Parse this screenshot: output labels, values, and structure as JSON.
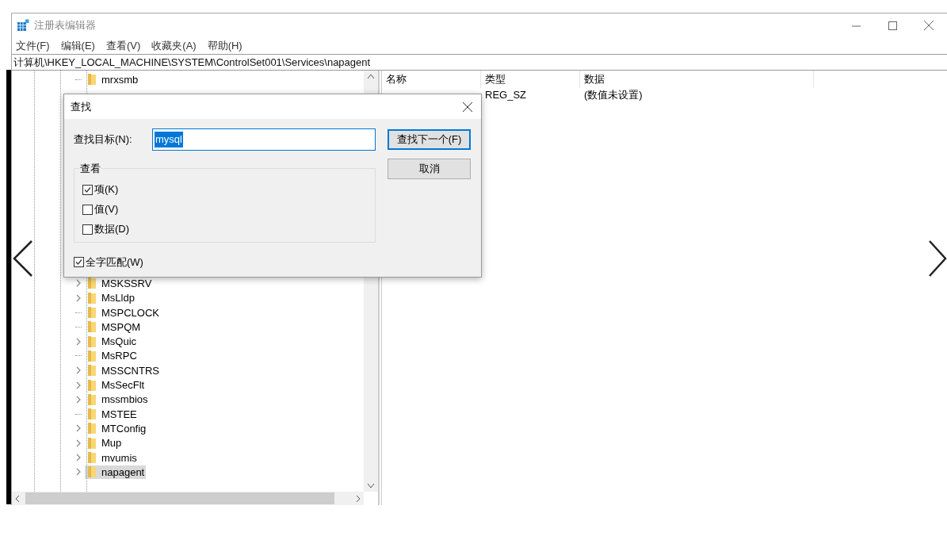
{
  "window": {
    "title": "注册表编辑器"
  },
  "menu": [
    "文件(F)",
    "编辑(E)",
    "查看(V)",
    "收藏夹(A)",
    "帮助(H)"
  ],
  "address": "计算机\\HKEY_LOCAL_MACHINE\\SYSTEM\\ControlSet001\\Services\\napagent",
  "tree": {
    "top_items": [
      {
        "label": "mrxsmb",
        "expandable": false,
        "selected": false
      }
    ],
    "items": [
      {
        "label": "MSKSSRV",
        "expandable": true,
        "selected": false
      },
      {
        "label": "MsLldp",
        "expandable": true,
        "selected": false
      },
      {
        "label": "MSPCLOCK",
        "expandable": false,
        "selected": false
      },
      {
        "label": "MSPQM",
        "expandable": false,
        "selected": false
      },
      {
        "label": "MsQuic",
        "expandable": true,
        "selected": false
      },
      {
        "label": "MsRPC",
        "expandable": false,
        "selected": false
      },
      {
        "label": "MSSCNTRS",
        "expandable": true,
        "selected": false
      },
      {
        "label": "MsSecFlt",
        "expandable": true,
        "selected": false
      },
      {
        "label": "mssmbios",
        "expandable": true,
        "selected": false
      },
      {
        "label": "MSTEE",
        "expandable": false,
        "selected": false
      },
      {
        "label": "MTConfig",
        "expandable": true,
        "selected": false
      },
      {
        "label": "Mup",
        "expandable": true,
        "selected": false
      },
      {
        "label": "mvumis",
        "expandable": true,
        "selected": false
      },
      {
        "label": "napagent",
        "expandable": true,
        "selected": true
      }
    ]
  },
  "values": {
    "columns": [
      "名称",
      "类型",
      "数据"
    ],
    "rows": [
      {
        "type": "REG_SZ",
        "data": "(数值未设置)"
      }
    ]
  },
  "find_dialog": {
    "title": "查找",
    "target_label": "查找目标(N):",
    "target_value": "mysql",
    "buttons": [
      {
        "label": "查找下一个(F)",
        "default": true
      },
      {
        "label": "取消",
        "default": false
      }
    ],
    "group_title": "查看",
    "options": [
      {
        "label": "项(K)",
        "checked": true
      },
      {
        "label": "值(V)",
        "checked": false
      },
      {
        "label": "数据(D)",
        "checked": false
      }
    ],
    "whole_match": {
      "label": "全字匹配(W)",
      "checked": true
    }
  }
}
